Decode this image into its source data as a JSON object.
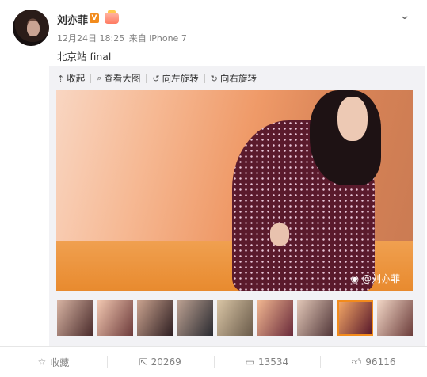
{
  "post": {
    "author": "刘亦菲",
    "verified_badge": "V",
    "time": "12月24日 18:25",
    "source": "来自 iPhone 7",
    "text": "北京站 final"
  },
  "viewer": {
    "toolbar": {
      "collapse": "收起",
      "view_large": "查看大图",
      "rotate_left": "向左旋转",
      "rotate_right": "向右旋转"
    },
    "watermark": "@刘亦菲",
    "thumbnail_count": 9,
    "selected_thumbnail": 8
  },
  "actions": {
    "favorite": "收藏",
    "repost": "20269",
    "comment": "13534",
    "like": "96116"
  },
  "icons": {
    "collapse": "collapse-up-icon",
    "view_large": "magnifier-icon",
    "rotate_left": "rotate-left-icon",
    "rotate_right": "rotate-right-icon",
    "favorite": "star-icon",
    "repost": "repost-icon",
    "comment": "comment-icon",
    "like": "thumbs-up-icon",
    "more": "chevron-down-icon",
    "watermark_logo": "weibo-logo-icon"
  },
  "colors": {
    "accent": "#f28b1c",
    "muted": "#808080",
    "text": "#333333"
  }
}
